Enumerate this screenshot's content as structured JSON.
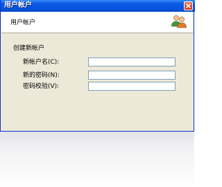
{
  "window": {
    "title": "用户帐户"
  },
  "header": {
    "title": "用户帐户",
    "icon": "users-icon"
  },
  "form": {
    "section_label": "创建新帐户",
    "fields": [
      {
        "label": "新帐户名(C):",
        "value": ""
      },
      {
        "label": "新的密码(N):",
        "value": ""
      },
      {
        "label": "密码校验(V):",
        "value": ""
      }
    ]
  },
  "colors": {
    "titlebar": "#0554e0",
    "dialog_bg": "#ece9d8",
    "close": "#d0331a",
    "input_border": "#7f9db9"
  }
}
